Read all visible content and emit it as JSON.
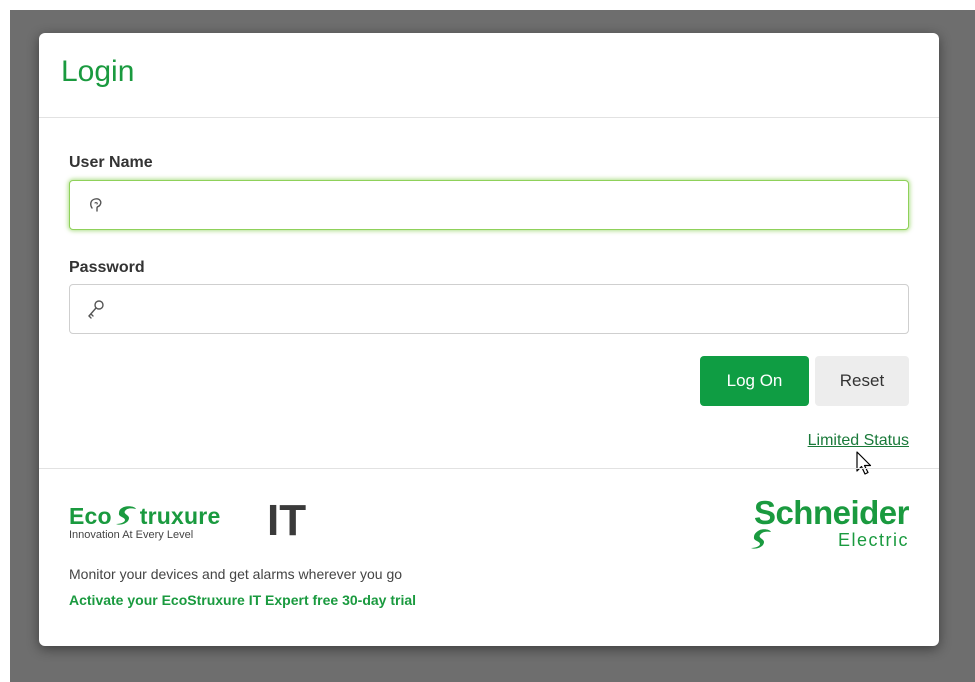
{
  "dialog": {
    "title": "Login"
  },
  "form": {
    "username": {
      "label": "User Name",
      "value": "",
      "placeholder": ""
    },
    "password": {
      "label": "Password",
      "value": "",
      "placeholder": ""
    },
    "logon_label": "Log On",
    "reset_label": "Reset",
    "limited_status_label": "Limited Status"
  },
  "footer": {
    "eco_brand": "EcoStruxure",
    "eco_brand_prefix": "Eco",
    "eco_brand_suffix": "truxure",
    "eco_tagline": "Innovation At Every Level",
    "it_mark": "IT",
    "description": "Monitor your devices and get alarms wherever you go",
    "trial_link": "Activate your EcoStruxure IT Expert free 30-day trial",
    "se_name": "Schneider",
    "se_sub": "Electric"
  },
  "icons": {
    "username_icon": "user-head-icon",
    "password_icon": "key-icon",
    "cursor": "mouse-pointer-icon"
  },
  "colors": {
    "brand_green": "#1a9a3f",
    "button_green": "#0f9d43",
    "focus_green": "#8fd15a",
    "backdrop": "#6e6e6e"
  }
}
